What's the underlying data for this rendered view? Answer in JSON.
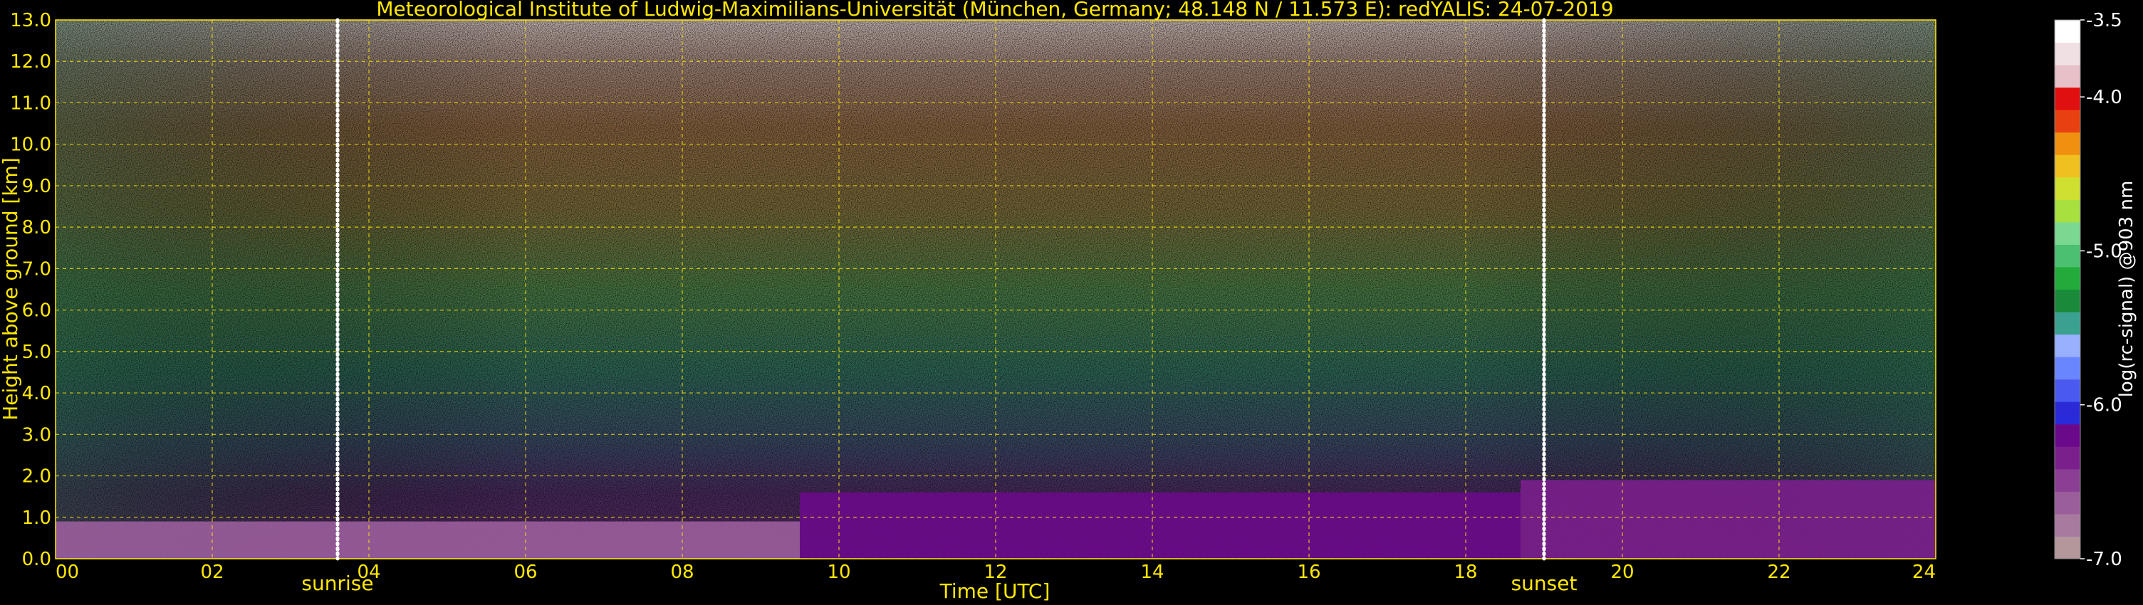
{
  "chart_data": {
    "type": "heatmap",
    "title": "Meteorological Institute of Ludwig-Maximilians-Universität (München, Germany; 48.148 N / 11.573 E):    redYALIS: 24-07-2019",
    "xlabel": "Time [UTC]",
    "ylabel": "Height above ground [km]",
    "xlim": [
      0,
      24
    ],
    "ylim": [
      0,
      13
    ],
    "x_ticks": [
      "00",
      "02",
      "04",
      "06",
      "08",
      "10",
      "12",
      "14",
      "16",
      "18",
      "20",
      "22",
      "24"
    ],
    "y_ticks": [
      "0.0",
      "1.0",
      "2.0",
      "3.0",
      "4.0",
      "5.0",
      "6.0",
      "7.0",
      "8.0",
      "9.0",
      "10.0",
      "11.0",
      "12.0",
      "13.0"
    ],
    "grid": true,
    "annotations": [
      {
        "label": "sunrise",
        "x": 3.6
      },
      {
        "label": "sunset",
        "x": 19.0
      }
    ],
    "colorbar": {
      "label": "log(rc-signal) @903 nm",
      "range": [
        -7.0,
        -3.5
      ],
      "ticks": [
        "-3.5",
        "-4.0",
        "-5.0",
        "-6.0",
        "-7.0"
      ],
      "colors": [
        "#b3979b",
        "#a87aa0",
        "#9a5e9c",
        "#8a3e94",
        "#7a1f8c",
        "#6a0a8a",
        "#2a2ad8",
        "#4a5af0",
        "#6a86ff",
        "#98b0ff",
        "#3aa090",
        "#1a8a3a",
        "#22aa3a",
        "#4ac070",
        "#7ad890",
        "#a8e040",
        "#d0e030",
        "#f0c020",
        "#f09010",
        "#e84010",
        "#e01010",
        "#e8c0c8",
        "#f0e0e4",
        "#ffffff"
      ]
    },
    "bands": [
      {
        "x0": 0,
        "x1": 9.5,
        "y0": 0.0,
        "y1": 0.9,
        "value": -6.6
      },
      {
        "x0": 9.5,
        "x1": 18.7,
        "y0": 0.0,
        "y1": 1.6,
        "value": -6.2
      },
      {
        "x0": 18.7,
        "x1": 24,
        "y0": 0.0,
        "y1": 1.9,
        "value": -6.3
      }
    ]
  }
}
